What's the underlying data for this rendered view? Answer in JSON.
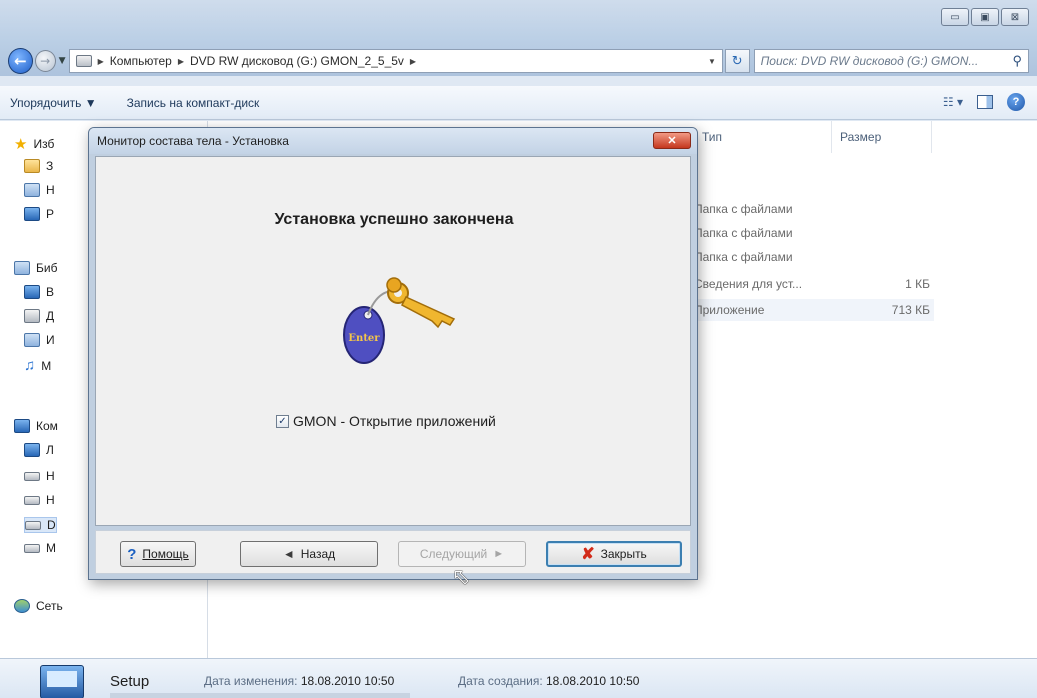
{
  "explorer": {
    "window_controls": {
      "minimize": "▭",
      "maximize": "▣",
      "close": "⊠"
    },
    "address_parts": [
      "Компьютер",
      "DVD RW дисковод (G:) GMON_2_5_5v"
    ],
    "search_placeholder": "Поиск: DVD RW дисковод (G:) GMON...",
    "toolbar": {
      "organize": "Упорядочить ▼",
      "burn": "Запись на компакт-диск",
      "views": "☷ ▾",
      "help": "?"
    },
    "nav": {
      "favorites": "Изб",
      "fav_items": [
        "З",
        "Н",
        "Р"
      ],
      "libraries": "Биб",
      "lib_items": [
        "В",
        "Д",
        "И",
        "М"
      ],
      "computer": "Ком",
      "comp_items": [
        "Л",
        "Н",
        "Н",
        "D",
        "М"
      ],
      "network": "Сеть"
    },
    "columns": {
      "type": "Тип",
      "size": "Размер"
    },
    "files": [
      {
        "type": "Папка с файлами",
        "size": ""
      },
      {
        "type": "Папка с файлами",
        "size": ""
      },
      {
        "type": "Папка с файлами",
        "size": ""
      },
      {
        "type": "Сведения для уст...",
        "size": "1 КБ"
      },
      {
        "type": "Приложение",
        "size": "713 КБ"
      }
    ],
    "details": {
      "name": "Setup",
      "modified_label": "Дата изменения:",
      "modified_value": "18.08.2010 10:50",
      "created_label": "Дата создания:",
      "created_value": "18.08.2010 10:50"
    }
  },
  "dialog": {
    "title": "Монитор состава тела - Установка",
    "close_glyph": "✕",
    "heading": "Установка успешно закончена",
    "key_tag_text": "Enter",
    "checkbox_label": "GMON - Открытие приложений",
    "checkbox_checked": true,
    "buttons": {
      "help": "Помощь",
      "back": "Назад",
      "next": "Следующий",
      "close": "Закрыть"
    }
  }
}
